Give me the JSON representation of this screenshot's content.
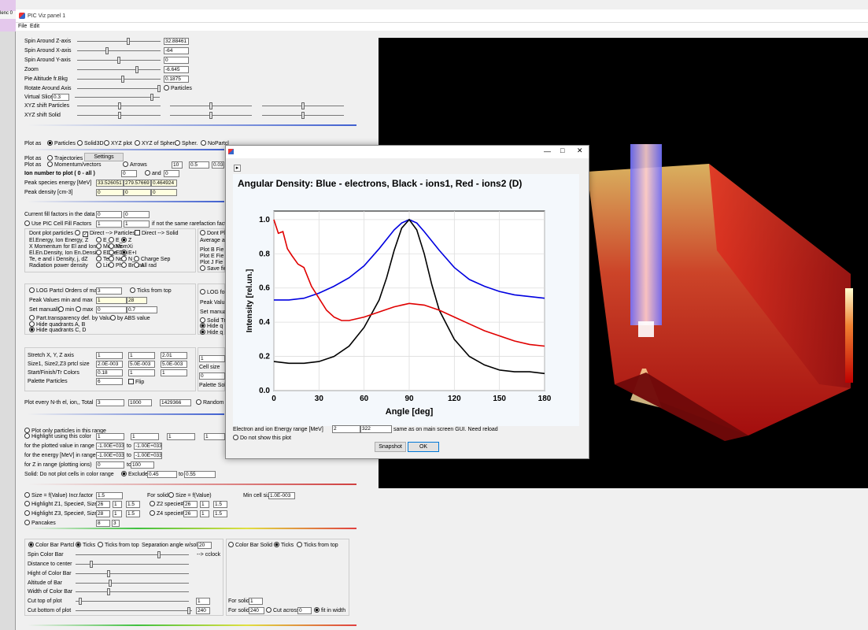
{
  "window": {
    "title": "PIC Viz panel 1",
    "menu": [
      "File",
      "Edit"
    ],
    "left_peek": "lenc 0"
  },
  "spin": {
    "rows": [
      {
        "label": "Spin Around Z-axis",
        "value": "32.88461",
        "thumb": 0.62
      },
      {
        "label": "Spin Around X-axis",
        "value": "-64",
        "thumb": 0.35
      },
      {
        "label": "Spin Around Y-axis",
        "value": "0",
        "thumb": 0.5
      },
      {
        "label": "Zoom",
        "value": "-6.645",
        "thumb": 0.73
      },
      {
        "label": "Pie Altitude fr.Bkg",
        "value": "0.1875",
        "thumb": 0.55
      },
      {
        "label": "Rotate Around Axis",
        "value": "Particles"
      }
    ],
    "virtual_slice_label": "Virtual Slice",
    "virtual_slice_value": "0.3",
    "xyz_particles": "XYZ shift Particles",
    "xyz_solid": "XYZ shift Solid"
  },
  "plotas": {
    "label": "Plot as",
    "options": [
      "Particles",
      "Solid3D",
      "XYZ plot",
      "XYZ of Spher.",
      "Spher.",
      "NoPartcl"
    ],
    "selected": "Particles"
  },
  "plotas2": {
    "label": "Plot as",
    "options": [
      "Trajectories",
      "Momentum/vectors",
      "Arrows"
    ],
    "settings": "Settings",
    "ar1": "10",
    "ar2": "0.5",
    "ar3": "0.03"
  },
  "ion": {
    "label": "Ion number to plot ( 0 - all )",
    "v1": "0",
    "and": "and",
    "v2": "0"
  },
  "peak": {
    "label": "Peak species energy [MeV]",
    "values": [
      "33.526051",
      "279.57669",
      "0.464924"
    ],
    "dens_label": "Peak density [cm-3]",
    "dens": [
      "0",
      "0",
      "0"
    ]
  },
  "fill": {
    "label": "Current fill factors in the data",
    "v1": "0",
    "v2": "0",
    "use_label": "Use PIC Cell Fill Factors",
    "u1": "1",
    "u2": "1",
    "note": "if not the same rarefaction factors"
  },
  "dont": {
    "label": "Dont plot particles",
    "d1": "Direct --> Particles",
    "d2": "Direct --> Solid"
  },
  "energy": {
    "rows": [
      {
        "label": "El.Energy, Ion Energy, Z",
        "opts": [
          "E_e",
          "E_i",
          "Z"
        ]
      },
      {
        "label": "X Momentum for El and Ions",
        "opts": [
          "MomXe",
          "MomXi"
        ]
      },
      {
        "label": "El.En.Density, Ion En.Density",
        "opts": [
          "ED_e",
          "ED_i",
          "E+I"
        ]
      },
      {
        "label": "Te, e and i Density, j, dZ",
        "opts": [
          "Te",
          "Ne",
          "N_i",
          "Charge Sep"
        ]
      },
      {
        "label": "Radiation power density",
        "opts": [
          "Lin",
          "Phr",
          "Brems",
          "All rad"
        ]
      }
    ]
  },
  "right_cut": {
    "a": "Dont Pl",
    "b": "Average a",
    "c": "Plot B Fie",
    "d": "Plot E Fie",
    "e": "Plot J Fie",
    "f": "Save fie",
    "g": "LOG for",
    "h": "Peak Valu",
    "i": "Set manual",
    "j": "Solid Tr",
    "k": "Hide q",
    "l": "Hide q",
    "m": "1",
    "n": "Cell size",
    "o": "0",
    "p": "Palette Soli",
    "q": "Random"
  },
  "log": {
    "label": "LOG Partcl Orders of mag",
    "value": "3",
    "ticks": "Ticks from top",
    "peak_label": "Peak Values min and max",
    "min": "1",
    "max": "28",
    "set_label": "Set manually",
    "min_lbl": "min",
    "max_lbl": "max",
    "sm1": "0",
    "sm2": "0.7",
    "transp": "Part.transparency def. by Value",
    "abs": "by ABS value",
    "hideab": "Hide quadrants A, B",
    "hidecd": "Hide quadrants C, D"
  },
  "stretch": {
    "rows": [
      {
        "label": "Stretch X, Y, Z axis",
        "vals": [
          "1",
          "1",
          "2.01"
        ]
      },
      {
        "label": "Size1, Size2,Z3 prtcl size",
        "vals": [
          "2.0E-003",
          "5.0E-003",
          "5.0E-003"
        ]
      },
      {
        "label": "Start/Finish/Tr Colors",
        "vals": [
          "0.18",
          "1",
          "1"
        ]
      },
      {
        "label": "Palette Particles",
        "vals": [
          "6"
        ]
      }
    ],
    "flip": "Flip"
  },
  "every": {
    "label": "Plot every N-th el, ion,, Total",
    "v1": "3",
    "v2": "1000",
    "v3": "1429366"
  },
  "range": {
    "only": "Plot only particles in this range",
    "highlight": "Highlight using this color",
    "h": [
      "1",
      "1",
      "1",
      "1"
    ],
    "r1": "for the plotted value in range",
    "r1a": "-1.00E+033",
    "r1b": "-1.00E+033",
    "r2": "for the energy [MeV] in range",
    "r2a": "-1.00E+033",
    "r2b": "-1.00E+033",
    "r3": "for Z in range (plotting ions)",
    "r3a": "0",
    "r3b": "100",
    "to": "to",
    "solid": "Solid: Do not plot cells in color range",
    "exclude": "Exclude",
    "s1": "0.45",
    "s2": "0.55"
  },
  "size": {
    "a": "Size = f(Value) Incr.factor",
    "av": "1.5",
    "b": "For solid",
    "c": "Size = f(Value)",
    "d": "Min cell size",
    "dv": "1.0E-003",
    "z1": "Highlight Z1, Specie#, Size",
    "z1v": [
      "26",
      "1",
      "1.5"
    ],
    "z2": "Z2 specie#",
    "z2v": [
      "26",
      "1",
      "1.5"
    ],
    "z3": "Highlight Z3, Specie#, Size",
    "z3v": [
      "28",
      "1",
      "1.5"
    ],
    "z4": "Z4 specie#",
    "z4v": [
      "26",
      "1",
      "1.5"
    ],
    "pan": "Pancakes",
    "panv": [
      "8",
      "3"
    ]
  },
  "colorbar": {
    "cb": "Color Bar Partcl",
    "ticks": "Ticks",
    "tft": "Ticks from top",
    "sep": "Separation angle w/solid",
    "sepv": "20",
    "spin": "Spin Color Bar",
    "cclock": "--> cclock",
    "dist": "Distance to center",
    "hight": "Hight of Color Bar",
    "alt": "Altitude of Bar",
    "width": "Width of Color Bar",
    "cuttop": "Cut top of plot",
    "cuttopv": "1",
    "cutbot": "Cut bottom of plot",
    "cutbotv": "240",
    "cbs": "Color Bar Solid",
    "ticks2": "Ticks",
    "tft2": "Ticks from top",
    "forsolid": "For solid",
    "fs1": "1",
    "fs2": "240",
    "cutacross": "Cut across",
    "cav": "0",
    "fit": "fit in width"
  },
  "dialog": {
    "title": "Angular Density:     Blue - electrons,  Black - ions1,  Red - ions2 (D)",
    "arrow": "▸",
    "energy_label": "Electron and ion Energy range [MeV]",
    "e1": "2",
    "e2": "322",
    "note": "same as on main screen GUI. Need reload",
    "noshow": "Do not show this plot",
    "snapshot": "Snapshot",
    "ok": "OK",
    "minimize": "—",
    "maximize": "□",
    "close": "✕"
  },
  "chart_data": {
    "type": "line",
    "title": "Angular Density:     Blue - electrons,  Black - ions1,  Red - ions2 (D)",
    "xlabel": "Angle [deg]",
    "ylabel": "Intensity [rel.un.]",
    "xlim": [
      0,
      180
    ],
    "ylim": [
      0,
      1.05
    ],
    "xticks": [
      0,
      30,
      60,
      90,
      120,
      150,
      180
    ],
    "yticks": [
      0.0,
      0.2,
      0.4,
      0.6,
      0.8,
      1.0
    ],
    "grid": true,
    "series": [
      {
        "color": "#0000e0",
        "x": [
          0,
          10,
          20,
          30,
          40,
          50,
          60,
          70,
          80,
          85,
          90,
          95,
          100,
          110,
          120,
          130,
          140,
          150,
          160,
          170,
          180
        ],
        "y": [
          0.53,
          0.53,
          0.54,
          0.57,
          0.61,
          0.66,
          0.73,
          0.83,
          0.94,
          0.98,
          1.0,
          0.98,
          0.93,
          0.82,
          0.72,
          0.65,
          0.61,
          0.58,
          0.56,
          0.55,
          0.54
        ]
      },
      {
        "color": "#000000",
        "x": [
          0,
          10,
          20,
          30,
          40,
          50,
          60,
          70,
          75,
          80,
          85,
          90,
          95,
          100,
          105,
          110,
          120,
          130,
          140,
          150,
          160,
          170,
          180
        ],
        "y": [
          0.17,
          0.16,
          0.16,
          0.17,
          0.2,
          0.26,
          0.37,
          0.53,
          0.66,
          0.82,
          0.95,
          1.0,
          0.94,
          0.8,
          0.62,
          0.47,
          0.3,
          0.2,
          0.15,
          0.12,
          0.11,
          0.11,
          0.1
        ]
      },
      {
        "color": "#e00000",
        "x": [
          0,
          3,
          6,
          9,
          12,
          16,
          20,
          25,
          30,
          35,
          40,
          45,
          50,
          60,
          70,
          80,
          90,
          100,
          110,
          120,
          130,
          140,
          150,
          160,
          170,
          180
        ],
        "y": [
          1.0,
          0.92,
          0.93,
          0.83,
          0.79,
          0.74,
          0.72,
          0.61,
          0.54,
          0.47,
          0.43,
          0.41,
          0.41,
          0.43,
          0.46,
          0.49,
          0.51,
          0.5,
          0.47,
          0.43,
          0.39,
          0.35,
          0.32,
          0.29,
          0.27,
          0.26
        ]
      }
    ]
  }
}
